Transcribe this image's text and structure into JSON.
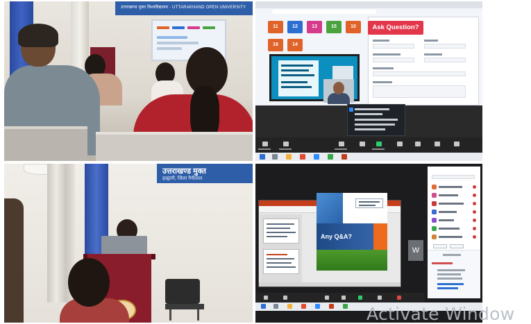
{
  "top_left_photo": {
    "banner_text": "उत्तराखण्ड मुक्त विश्वविद्यालय · UTTARAKHAND OPEN UNIVERSITY"
  },
  "top_right_zoom": {
    "tiles": [
      "11",
      "12",
      "13",
      "15",
      "10",
      "16",
      "14"
    ],
    "tile_colors": [
      "#e0642a",
      "#2d6fd1",
      "#d63a8a",
      "#4aa33e",
      "#e0642a",
      "#e0642a",
      "#e0642a"
    ],
    "ask_title": "Ask Question?"
  },
  "bottom_left_photo": {
    "banner_text": "उत्तराखण्ड मुक्त",
    "banner_sub": "हल्द्वानी, जिला नैनीताल"
  },
  "bottom_right_zoom": {
    "slide_text": "Any Q&A?",
    "participant_tile": "W"
  },
  "watermark": "Activate Window",
  "colors": {
    "banner_blue": "#2f5ea8",
    "curtain_blue": "#2a4aa0",
    "podium_maroon": "#7a1f2b",
    "ask_red": "#e3364b"
  }
}
